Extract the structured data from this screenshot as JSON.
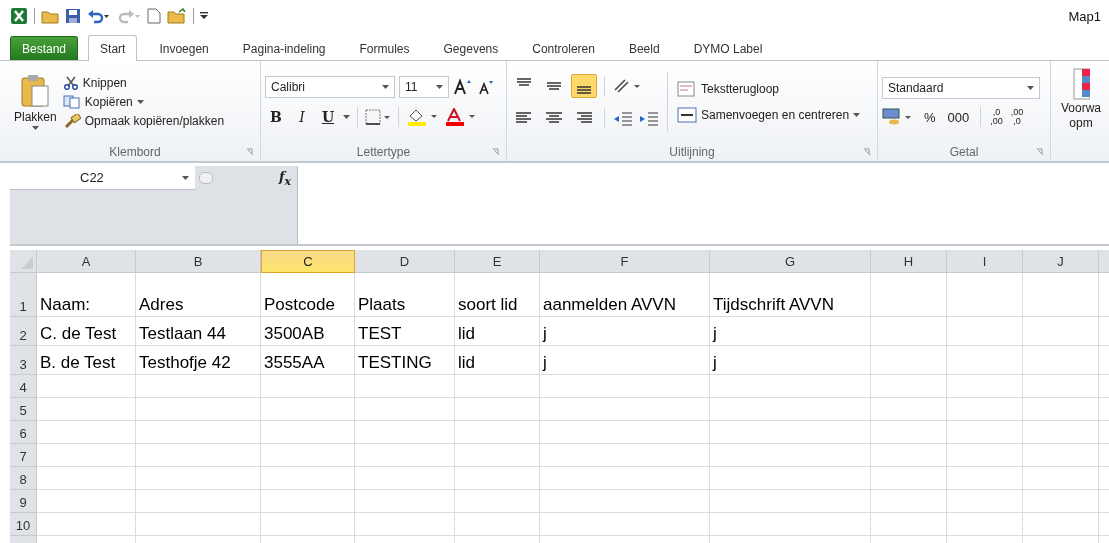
{
  "window": {
    "title": "Map1"
  },
  "tabs": [
    {
      "label": "Bestand",
      "kind": "file",
      "selected": false
    },
    {
      "label": "Start",
      "kind": "tab",
      "selected": true
    },
    {
      "label": "Invoegen",
      "kind": "tab",
      "selected": false
    },
    {
      "label": "Pagina-indeling",
      "kind": "tab",
      "selected": false
    },
    {
      "label": "Formules",
      "kind": "tab",
      "selected": false
    },
    {
      "label": "Gegevens",
      "kind": "tab",
      "selected": false
    },
    {
      "label": "Controleren",
      "kind": "tab",
      "selected": false
    },
    {
      "label": "Beeld",
      "kind": "tab",
      "selected": false
    },
    {
      "label": "DYMO Label",
      "kind": "tab",
      "selected": false
    }
  ],
  "ribbon": {
    "clipboard": {
      "paste": "Plakken",
      "cut": "Knippen",
      "copy": "Kopiëren",
      "format_painter": "Opmaak kopiëren/plakken",
      "label": "Klembord"
    },
    "font": {
      "name": "Calibri",
      "size": "11",
      "bold": "B",
      "italic": "I",
      "underline": "U",
      "label": "Lettertype"
    },
    "alignment": {
      "bottom_align_on": true,
      "wrap": "Tekstterugloop",
      "merge": "Samenvoegen en centreren",
      "label": "Uitlijning"
    },
    "number": {
      "format": "Standaard",
      "percent": "%",
      "thousands": "000",
      "add_decimal": [
        ",0",
        ",00"
      ],
      "remove_decimal": [
        ",00",
        ",0"
      ],
      "label": "Getal"
    },
    "styles": {
      "label_line_1": "Voorwa",
      "label_line_2": "opm"
    }
  },
  "formula_bar": {
    "name_box": "C22",
    "fx": "f$_{x}$"
  },
  "sheet": {
    "columns": [
      {
        "label": "A",
        "selected": false
      },
      {
        "label": "B",
        "selected": false
      },
      {
        "label": "C",
        "selected": true
      },
      {
        "label": "D",
        "selected": false
      },
      {
        "label": "E",
        "selected": false
      },
      {
        "label": "F",
        "selected": false
      },
      {
        "label": "G",
        "selected": false
      },
      {
        "label": "H",
        "selected": false
      },
      {
        "label": "I",
        "selected": false
      },
      {
        "label": "J",
        "selected": false
      }
    ],
    "rows": [
      {
        "number": "1",
        "cells": [
          "Naam:",
          "Adres",
          "Postcode",
          "Plaats",
          "soort lid",
          "aanmelden AVVN",
          "Tijdschrift AVVN"
        ]
      },
      {
        "number": "2",
        "cells": [
          "C. de Test",
          "Testlaan 44",
          "3500AB",
          "TEST",
          "lid",
          "j",
          "j"
        ]
      },
      {
        "number": "3",
        "cells": [
          "B. de Test",
          "Testhofje 42",
          "3555AA",
          "TESTING",
          "lid",
          "j",
          "j"
        ]
      },
      {
        "number": "4",
        "cells": []
      },
      {
        "number": "5",
        "cells": []
      },
      {
        "number": "6",
        "cells": []
      },
      {
        "number": "7",
        "cells": []
      },
      {
        "number": "8",
        "cells": []
      },
      {
        "number": "9",
        "cells": []
      },
      {
        "number": "10",
        "cells": []
      }
    ]
  }
}
